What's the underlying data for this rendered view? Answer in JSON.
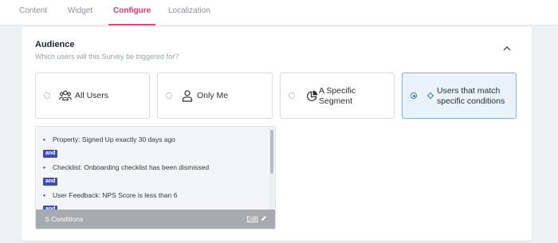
{
  "tabs": [
    {
      "label": "Content"
    },
    {
      "label": "Widget"
    },
    {
      "label": "Configure",
      "active": true
    },
    {
      "label": "Localization"
    }
  ],
  "audience": {
    "title": "Audience",
    "subtitle": "Which users will this Survey be triggered for?",
    "options": [
      {
        "label": "All Users",
        "icon": "users-group-icon",
        "selected": false
      },
      {
        "label": "Only Me",
        "icon": "user-icon",
        "selected": false
      },
      {
        "label_line1": "A Specific",
        "label_line2": "Segment",
        "icon": "pie-chart-icon",
        "selected": false
      },
      {
        "label_line1": "Users that match",
        "label_line2": "specific conditions",
        "icon": "diamond-icon",
        "selected": true
      }
    ]
  },
  "conditions": {
    "items": [
      {
        "text": "Property: Signed Up exactly 30 days ago"
      },
      {
        "text": "Checklist: Onboarding checklist has been dismissed"
      },
      {
        "text": "User Feedback: NPS Score is less than 6"
      }
    ],
    "connector": "and",
    "count_label": "5 Conditions",
    "edit_label": "Edit"
  },
  "colors": {
    "accent": "#e4467a",
    "selected_bg": "#eaf3fb",
    "selected_border": "#7fb2e0",
    "badge": "#3d4db8"
  }
}
